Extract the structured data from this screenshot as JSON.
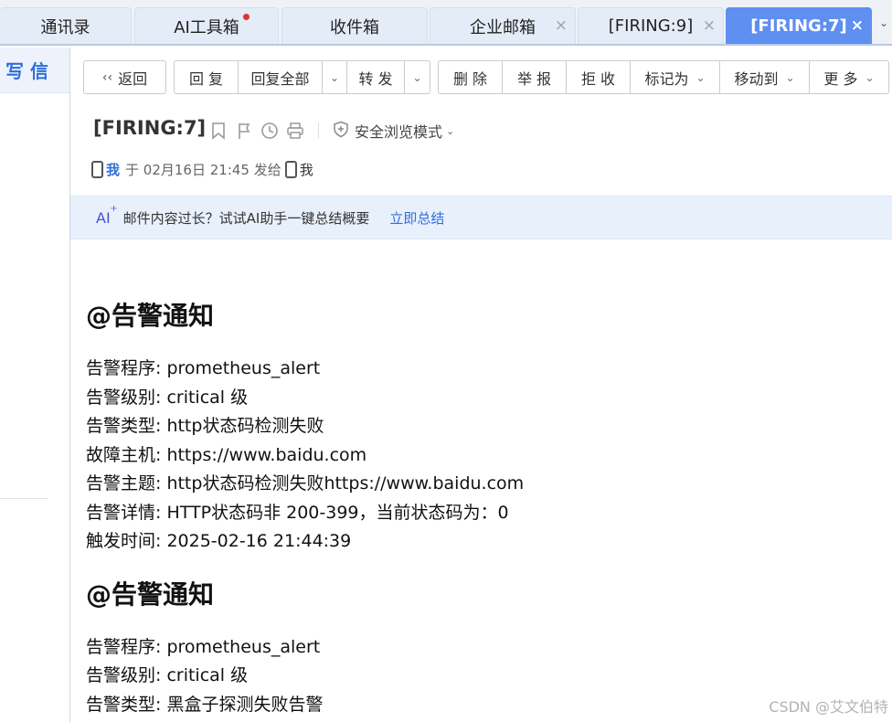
{
  "tabs": [
    {
      "label": "通讯录"
    },
    {
      "label": "AI工具箱",
      "has_dot": true
    },
    {
      "label": "收件箱"
    },
    {
      "label": "企业邮箱",
      "closable": true
    },
    {
      "label": "[FIRING:9]",
      "closable": true
    },
    {
      "label": "[FIRING:7]",
      "closable": true,
      "active": true
    }
  ],
  "tab_close_glyph": "×",
  "sidebar": {
    "compose_label": "写 信"
  },
  "toolbar": {
    "back_label": "返回",
    "reply_label": "回 复",
    "reply_all_label": "回复全部",
    "forward_label": "转 发",
    "delete_label": "删 除",
    "report_label": "举 报",
    "reject_label": "拒 收",
    "mark_as_label": "标记为",
    "move_to_label": "移动到",
    "more_label": "更 多"
  },
  "mail": {
    "subject": "[FIRING:7]",
    "safe_mode_label": "安全浏览模式",
    "sender": "我",
    "sent_text": "于 02月16日 21:45 发给",
    "recipient": "我"
  },
  "ai_bar": {
    "badge": "AI",
    "badge_star": "+",
    "text": "邮件内容过长？试试AI助手一键总结概要",
    "link": "立即总结"
  },
  "alerts": [
    {
      "heading": "@告警通知",
      "lines": [
        "告警程序: prometheus_alert",
        "告警级别: critical 级",
        "告警类型: http状态码检测失败",
        "故障主机: https://www.baidu.com",
        "告警主题: http状态码检测失败https://www.baidu.com",
        "告警详情: HTTP状态码非 200-399，当前状态码为：0",
        "触发时间: 2025-02-16 21:44:39"
      ]
    },
    {
      "heading": "@告警通知",
      "lines": [
        "告警程序: prometheus_alert",
        "告警级别: critical 级",
        "告警类型: 黑盒子探测失败告警"
      ]
    }
  ],
  "watermark": "CSDN @艾文伯特",
  "colors": {
    "accent": "#2f6fd8",
    "active_tab": "#5f8ff0",
    "ai_bar_bg": "#e8f0fc"
  }
}
